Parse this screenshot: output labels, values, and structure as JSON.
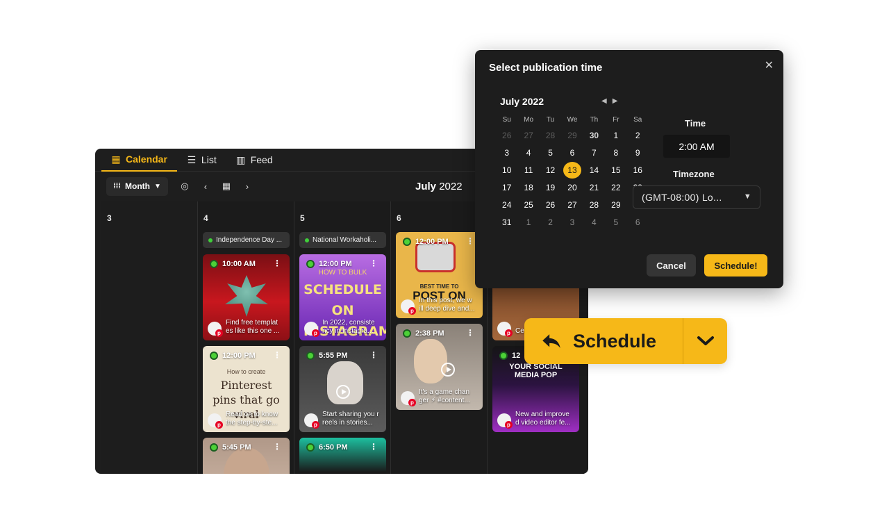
{
  "tabs": [
    {
      "label": "Calendar",
      "icon": "calendar-icon"
    },
    {
      "label": "List",
      "icon": "list-icon"
    },
    {
      "label": "Feed",
      "icon": "feed-icon"
    }
  ],
  "toolbar": {
    "view_label": "Month",
    "month": "July",
    "year": "2022"
  },
  "days": [
    {
      "num": "3"
    },
    {
      "num": "4",
      "holiday": "Independence Day ..."
    },
    {
      "num": "5",
      "holiday": "National Workaholi..."
    },
    {
      "num": "6"
    }
  ],
  "posts": {
    "d4p1": {
      "time": "10:00 AM",
      "text": "Find free templat es like this one ..."
    },
    "d4p2": {
      "time": "12:00 PM",
      "text": "Read on to know the step-by-ste...",
      "art_top": "How to create",
      "art_main": "Pinterest pins that go viral"
    },
    "d4p3": {
      "time": "5:45 PM"
    },
    "d5p1": {
      "time": "12:00 PM",
      "text": "In 2022, consiste ncy in Instagra...",
      "art_top": "HOW TO BULK",
      "art_main": "SCHEDULE ON INSTAGRAM"
    },
    "d5p2": {
      "time": "5:55 PM",
      "text": "Start sharing you r reels in stories..."
    },
    "d5p3": {
      "time": "6:50 PM"
    },
    "d6p1": {
      "time": "12:00 PM",
      "text": "In this post, we w ill deep dive and...",
      "art_top": "BEST TIME TO",
      "art_main": "POST ON"
    },
    "d6p2": {
      "time": "2:38 PM",
      "text": "It's a game chan ger ⚡ #content..."
    },
    "d7p1": {
      "text": "Cel ol..."
    },
    "d7p2": {
      "time": "12",
      "text": "New and improve d video editor fe...",
      "art_main": "YOUR SOCIAL MEDIA POP"
    }
  },
  "dialog": {
    "title": "Select publication time",
    "month_label": "July 2022",
    "weekdays": [
      "Su",
      "Mo",
      "Tu",
      "We",
      "Th",
      "Fr",
      "Sa"
    ],
    "weeks": [
      [
        "26",
        "27",
        "28",
        "29",
        "30",
        "1",
        "2"
      ],
      [
        "3",
        "4",
        "5",
        "6",
        "7",
        "8",
        "9"
      ],
      [
        "10",
        "11",
        "12",
        "13",
        "14",
        "15",
        "16"
      ],
      [
        "17",
        "18",
        "19",
        "20",
        "21",
        "22",
        "23"
      ],
      [
        "24",
        "25",
        "26",
        "27",
        "28",
        "29",
        "30"
      ],
      [
        "31",
        "1",
        "2",
        "3",
        "4",
        "5",
        "6"
      ]
    ],
    "selected_day": "13",
    "time_label": "Time",
    "time_value": "2:00 AM",
    "timezone_label": "Timezone",
    "timezone_value": "(GMT-08:00) Lo...",
    "cancel_label": "Cancel",
    "schedule_label": "Schedule!"
  },
  "big_button": {
    "label": "Schedule"
  },
  "colors": {
    "accent": "#f6b818",
    "panel": "#1e1e1e",
    "pinterest": "#e60023",
    "status_green": "#4cd137"
  }
}
